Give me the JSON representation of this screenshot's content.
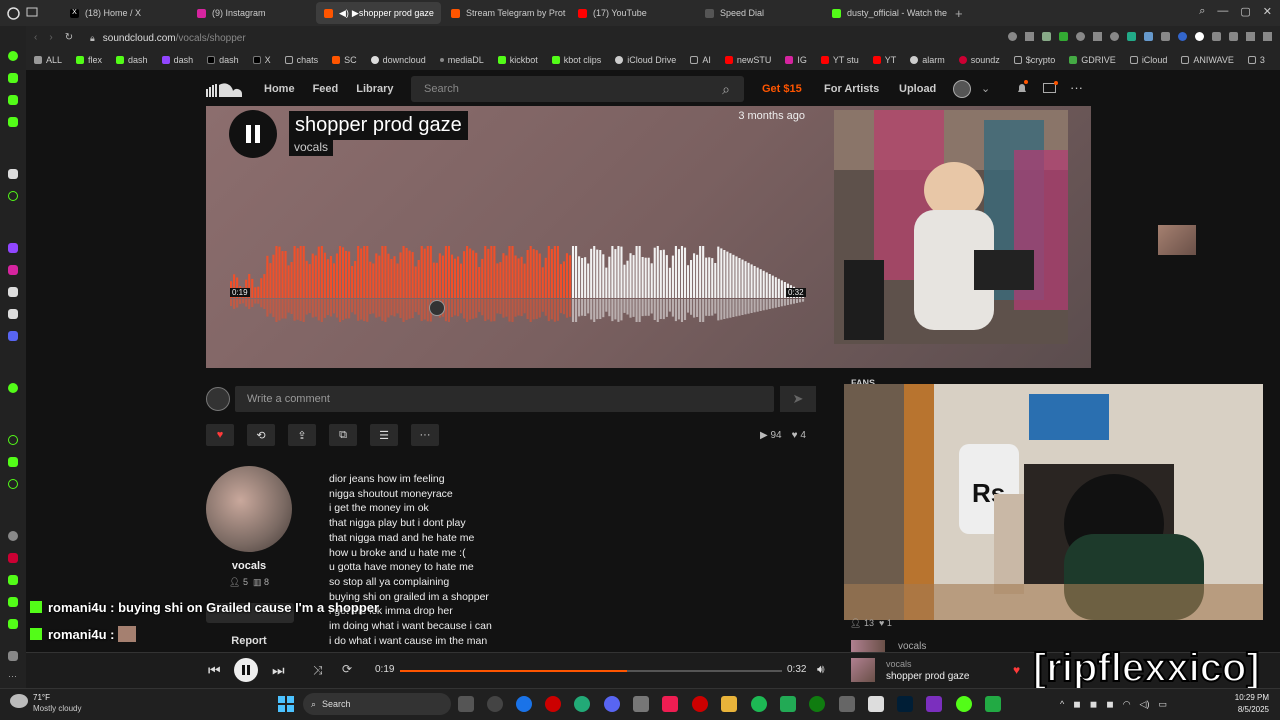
{
  "tabs": [
    {
      "label": "(18) Home / X",
      "color": "#000000"
    },
    {
      "label": "(9) Instagram",
      "color": "#d6249f"
    },
    {
      "label": "shopper prod gaze",
      "color": "#ff5500"
    },
    {
      "label": "Stream Telegram by Prot",
      "color": "#ff5500"
    },
    {
      "label": "(17) YouTube",
      "color": "#ff0000"
    },
    {
      "label": "Speed Dial",
      "color": "#666666"
    },
    {
      "label": "dusty_official - Watch the",
      "color": "#53fc18"
    }
  ],
  "url": {
    "host": "soundcloud.com",
    "path": "/vocals/shopper"
  },
  "bookmarks": [
    "ALL",
    "flex",
    "dash",
    "dash",
    "dash",
    "X",
    "chats",
    "SC",
    "downcloud",
    "mediaDL",
    "kickbot",
    "kbot clips",
    "iCloud Drive",
    "AI",
    "newSTU",
    "IG",
    "YT stu",
    "YT",
    "alarm",
    "soundz",
    "$crypto",
    "GDRIVE",
    "iCloud",
    "ANIWAVE",
    "3"
  ],
  "sc": {
    "nav": [
      "Home",
      "Feed",
      "Library"
    ],
    "search_placeholder": "Search",
    "get_offer": "Get $15",
    "for_artists": "For Artists",
    "upload": "Upload"
  },
  "track": {
    "title": "shopper prod gaze",
    "artist": "vocals",
    "posted": "3 months ago",
    "time_current": "0:19",
    "time_total": "0:32",
    "progress": 0.594,
    "plays": "94",
    "likes": "4"
  },
  "comment_placeholder": "Write a comment",
  "user": {
    "name": "vocals",
    "followers": "5",
    "tracks": "8",
    "report": "Report"
  },
  "lyrics": [
    "dior jeans how im feeling",
    "nigga shoutout moneyrace",
    "i get the money im ok",
    "that nigga play but i dont play",
    "that nigga mad and he hate me",
    "how u broke and u hate me :(",
    "u gotta have money to hate me",
    "so stop all ya complaining",
    "buying shi on grailed im a shopper",
    "i get the ick imma drop her",
    "im doing what i want because i can",
    "i do what i want cause im the man"
  ],
  "fans_label": "FANS",
  "fan_stats": {
    "followers": "13",
    "likes": "1"
  },
  "sidebar_track": {
    "artist": "vocals"
  },
  "chat": [
    {
      "user": "romani4u",
      "message": "buying shi on Grailed cause I'm a shopper"
    },
    {
      "user": "romani4u",
      "message": ""
    }
  ],
  "player": {
    "current": "0:19",
    "total": "0:32",
    "artist": "vocals",
    "title": "shopper prod gaze"
  },
  "watermark": "[ripflexxico]",
  "weather": {
    "temp": "71°F",
    "cond": "Mostly cloudy"
  },
  "taskbar_search": "Search",
  "clock": {
    "time": "10:29 PM",
    "date": "8/5/2025"
  },
  "colors": {
    "accent": "#ff5500",
    "played": "#f0502a",
    "unplayed": "#f2f2f2"
  }
}
